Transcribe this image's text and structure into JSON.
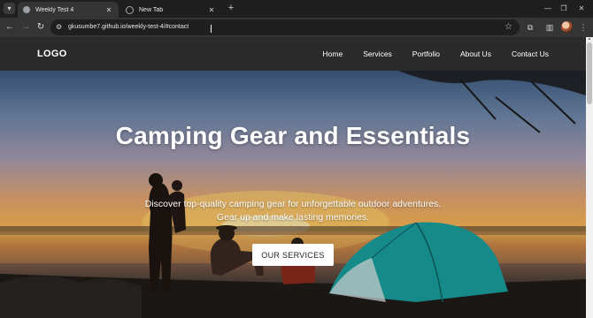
{
  "browser": {
    "tabs": [
      {
        "title": "Weekly Test 4",
        "active": true
      },
      {
        "title": "New Tab",
        "active": false
      }
    ],
    "new_tab_symbol": "+",
    "close_symbol": "✕",
    "url": "gkusumbe7.github.io/weekly-test-4/#contact",
    "window_controls": {
      "minimize": "—",
      "restore": "❐",
      "close": "✕"
    },
    "icons": {
      "back": "←",
      "forward": "→",
      "reload": "↻",
      "site_info": "⚙",
      "bookmark": "☆",
      "extensions": "⧉",
      "side_panel": "▥",
      "menu": "⋮",
      "tab_search": "▾"
    }
  },
  "site": {
    "logo": "LOGO",
    "nav": [
      "Home",
      "Services",
      "Portfolio",
      "About Us",
      "Contact Us"
    ]
  },
  "hero": {
    "title": "Camping Gear and Essentials",
    "subtitle_line1": "Discover top-quality camping gear for unforgettable outdoor adventures.",
    "subtitle_line2": "Gear up and make lasting memories.",
    "cta_label": "OUR SERVICES"
  },
  "colors": {
    "nav_bg": "#2b2b2b",
    "tent": "#1a9c9c",
    "button_bg": "#ffffff"
  }
}
